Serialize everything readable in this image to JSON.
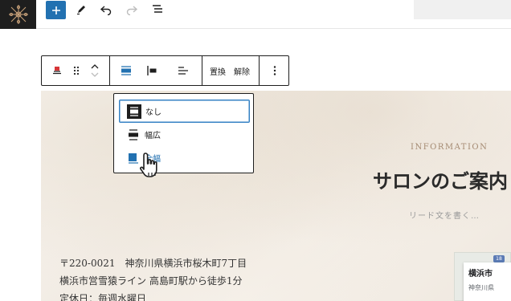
{
  "topbar": {
    "icons": [
      "site-logo-icon",
      "plus-icon",
      "pencil-icon",
      "undo-icon",
      "redo-icon",
      "list-view-icon"
    ]
  },
  "block_toolbar": {
    "replace_label": "置換",
    "unlink_label": "解除",
    "icons": [
      "block-type-icon",
      "drag-handle-icon",
      "move-up-icon",
      "move-down-icon",
      "align-full-icon",
      "align-left-icon",
      "justify-icon",
      "more-options-icon"
    ]
  },
  "dropdown": {
    "items": [
      {
        "label": "なし",
        "icon": "align-none-icon",
        "selected": true
      },
      {
        "label": "幅広",
        "icon": "align-wide-icon",
        "selected": false
      },
      {
        "label": "全幅",
        "icon": "align-full-icon",
        "selected": false,
        "hovered": true
      }
    ]
  },
  "content": {
    "info_label": "INFORMATION",
    "title": "サロンのご案内",
    "lead": "リード文を書く…",
    "address_lines": [
      "〒220-0021　神奈川県横浜市桜木町7丁目",
      "横浜市営雪猿ライン 高島町駅から徒歩1分",
      "定休日：毎週水曜日"
    ]
  },
  "map": {
    "city": "横浜市",
    "prefecture": "神奈川県",
    "badge": "18"
  },
  "colors": {
    "accent": "#2271b1",
    "selected_border": "#3582c4",
    "dark": "#1e1e1e"
  }
}
